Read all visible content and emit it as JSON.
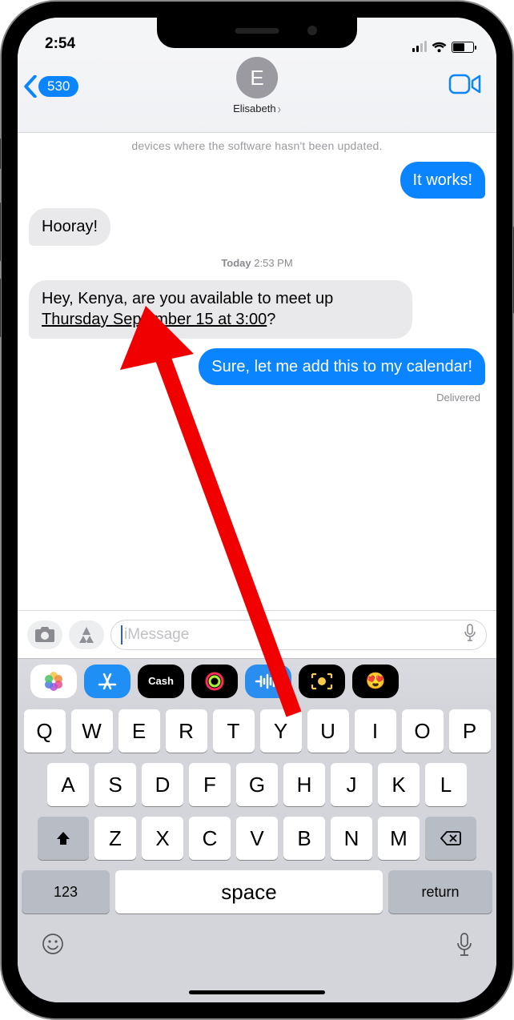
{
  "status": {
    "time": "2:54"
  },
  "nav": {
    "back_badge": "530",
    "avatar_letter": "E",
    "contact_name": "Elisabeth"
  },
  "truncated_preview": "devices where the software hasn't been updated.",
  "messages": {
    "m1": "It works!",
    "m2": "Hooray!",
    "ts_day": "Today",
    "ts_time": "2:53 PM",
    "m3_pre": "Hey, Kenya, are you available to meet up ",
    "m3_underlined": "Thursday September 15 at 3:00",
    "m3_post": "?",
    "m4": "Sure, let me add this to my calendar!",
    "delivered": "Delivered"
  },
  "input": {
    "placeholder": "iMessage"
  },
  "keyboard": {
    "row1": [
      "Q",
      "W",
      "E",
      "R",
      "T",
      "Y",
      "U",
      "I",
      "O",
      "P"
    ],
    "row2": [
      "A",
      "S",
      "D",
      "F",
      "G",
      "H",
      "J",
      "K",
      "L"
    ],
    "row3": [
      "Z",
      "X",
      "C",
      "V",
      "B",
      "N",
      "M"
    ],
    "numbers": "123",
    "space": "space",
    "return": "return"
  }
}
